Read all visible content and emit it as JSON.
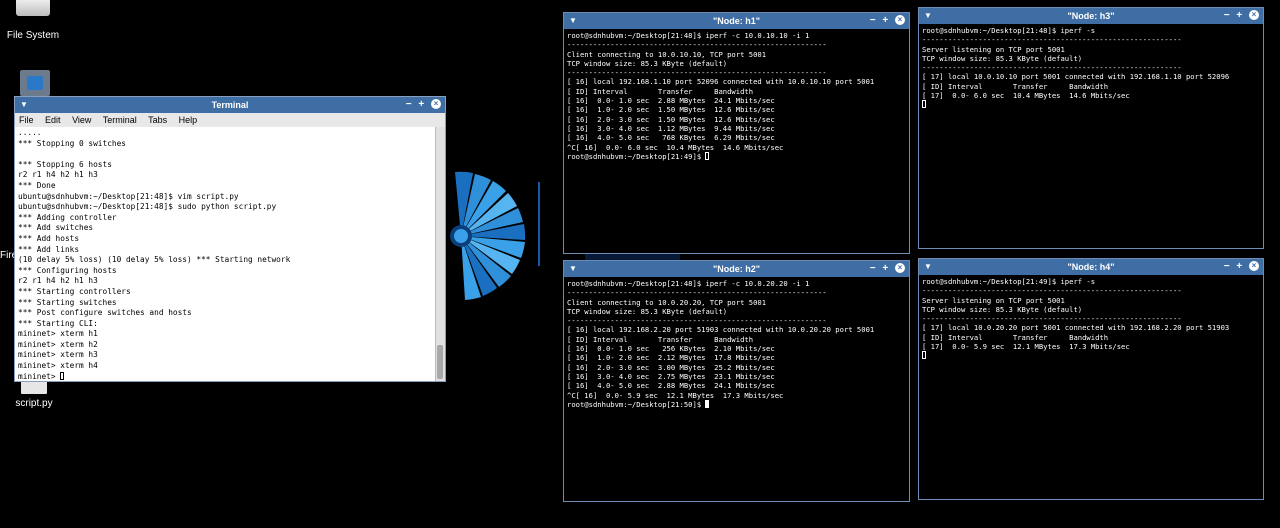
{
  "desktop": {
    "icons": {
      "filesystem": "File System",
      "home": "",
      "firefox_partial": "Fire",
      "script": "script.py"
    }
  },
  "main_terminal": {
    "title": "Terminal",
    "menu": [
      "File",
      "Edit",
      "View",
      "Terminal",
      "Tabs",
      "Help"
    ],
    "text": ".....\n*** Stopping 0 switches\n\n*** Stopping 6 hosts\nr2 r1 h4 h2 h1 h3\n*** Done\nubuntu@sdnhubvm:~/Desktop[21:48]$ vim script.py\nubuntu@sdnhubvm:~/Desktop[21:48]$ sudo python script.py\n*** Adding controller\n*** Add switches\n*** Add hosts\n*** Add links\n(10 delay 5% loss) (10 delay 5% loss) *** Starting network\n*** Configuring hosts\nr2 r1 h4 h2 h1 h3\n*** Starting controllers\n*** Starting switches\n*** Post configure switches and hosts\n*** Starting CLI:\nmininet> xterm h1\nmininet> xterm h2\nmininet> xterm h3\nmininet> xterm h4\nmininet> "
  },
  "xterms": {
    "h1": {
      "title": "\"Node: h1\"",
      "text": "root@sdnhubvm:~/Desktop[21:48]$ iperf -c 10.0.10.10 -i 1\n------------------------------------------------------------\nClient connecting to 10.0.10.10, TCP port 5001\nTCP window size: 85.3 KByte (default)\n------------------------------------------------------------\n[ 16] local 192.168.1.10 port 52096 connected with 10.0.10.10 port 5001\n[ ID] Interval       Transfer     Bandwidth\n[ 16]  0.0- 1.0 sec  2.88 MBytes  24.1 Mbits/sec\n[ 16]  1.0- 2.0 sec  1.50 MBytes  12.6 Mbits/sec\n[ 16]  2.0- 3.0 sec  1.50 MBytes  12.6 Mbits/sec\n[ 16]  3.0- 4.0 sec  1.12 MBytes  9.44 Mbits/sec\n[ 16]  4.0- 5.0 sec   768 KBytes  6.29 Mbits/sec\n^C[ 16]  0.0- 6.0 sec  10.4 MBytes  14.6 Mbits/sec\nroot@sdnhubvm:~/Desktop[21:49]$ "
    },
    "h2": {
      "title": "\"Node: h2\"",
      "text": "root@sdnhubvm:~/Desktop[21:48]$ iperf -c 10.0.20.20 -i 1\n------------------------------------------------------------\nClient connecting to 10.0.20.20, TCP port 5001\nTCP window size: 85.3 KByte (default)\n------------------------------------------------------------\n[ 16] local 192.168.2.20 port 51903 connected with 10.0.20.20 port 5001\n[ ID] Interval       Transfer     Bandwidth\n[ 16]  0.0- 1.0 sec   256 KBytes  2.10 Mbits/sec\n[ 16]  1.0- 2.0 sec  2.12 MBytes  17.8 Mbits/sec\n[ 16]  2.0- 3.0 sec  3.00 MBytes  25.2 Mbits/sec\n[ 16]  3.0- 4.0 sec  2.75 MBytes  23.1 Mbits/sec\n[ 16]  4.0- 5.0 sec  2.88 MBytes  24.1 Mbits/sec\n^C[ 16]  0.0- 5.9 sec  12.1 MBytes  17.3 Mbits/sec\nroot@sdnhubvm:~/Desktop[21:50]$ "
    },
    "h3": {
      "title": "\"Node: h3\"",
      "text": "root@sdnhubvm:~/Desktop[21:48]$ iperf -s\n------------------------------------------------------------\nServer listening on TCP port 5001\nTCP window size: 85.3 KByte (default)\n------------------------------------------------------------\n[ 17] local 10.0.10.10 port 5001 connected with 192.168.1.10 port 52096\n[ ID] Interval       Transfer     Bandwidth\n[ 17]  0.0- 6.0 sec  10.4 MBytes  14.6 Mbits/sec\n"
    },
    "h4": {
      "title": "\"Node: h4\"",
      "text": "root@sdnhubvm:~/Desktop[21:49]$ iperf -s\n------------------------------------------------------------\nServer listening on TCP port 5001\nTCP window size: 85.3 KByte (default)\n------------------------------------------------------------\n[ 17] local 10.0.20.20 port 5001 connected with 192.168.2.20 port 51903\n[ ID] Interval       Transfer     Bandwidth\n[ 17]  0.0- 5.9 sec  12.1 MBytes  17.3 Mbits/sec\n"
    }
  },
  "window_controls": {
    "minimize": "−",
    "maximize": "+",
    "close": "×"
  },
  "colors": {
    "titlebar": "#3f6ea4",
    "desktop": "#000000",
    "logo_blue": "#2f8fd8"
  }
}
